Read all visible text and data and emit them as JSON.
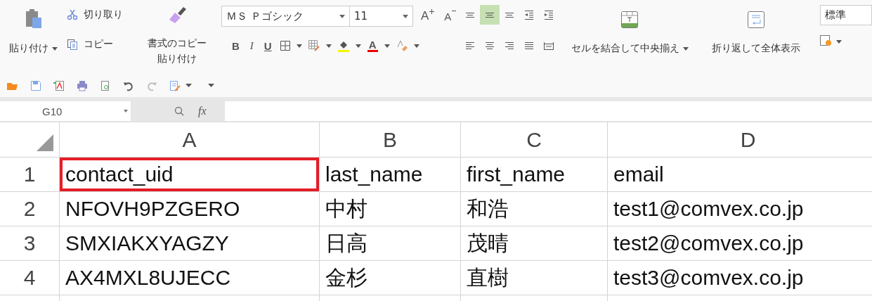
{
  "ribbon": {
    "clipboard": {
      "paste": "貼り付け",
      "cut": "切り取り",
      "copy": "コピー",
      "format_painter": "書式のコピー貼り付け"
    },
    "font": {
      "name": "ＭＳ Ｐゴシック",
      "size": "11",
      "grow": "A",
      "shrink": "A",
      "bold": "B",
      "italic": "I",
      "underline": "U",
      "font_color": "A"
    },
    "alignment": [
      {
        "kind": "top",
        "selected": false
      },
      {
        "kind": "middle",
        "selected": true
      },
      {
        "kind": "bottom",
        "selected": false
      },
      {
        "kind": "outdent",
        "selected": false
      },
      {
        "kind": "indent",
        "selected": false
      },
      {
        "kind": "left",
        "selected": false
      },
      {
        "kind": "center",
        "selected": false
      },
      {
        "kind": "right",
        "selected": false
      },
      {
        "kind": "justify",
        "selected": false
      },
      {
        "kind": "distributed",
        "selected": false
      }
    ],
    "merge": "セルを結合して中央揃え",
    "wrap": "折り返して全体表示",
    "number_format": "標準",
    "quick_access": [
      {
        "kind": "open",
        "disabled": false
      },
      {
        "kind": "save",
        "disabled": false
      },
      {
        "kind": "pdf",
        "disabled": false
      },
      {
        "kind": "print",
        "disabled": false
      },
      {
        "kind": "preview",
        "disabled": false
      },
      {
        "kind": "undo",
        "disabled": false
      },
      {
        "kind": "redo",
        "disabled": true
      },
      {
        "kind": "form",
        "disabled": false
      }
    ]
  },
  "formula_bar": {
    "name_box": "G10",
    "fx": "fx"
  },
  "sheet": {
    "columns": [
      "A",
      "B",
      "C",
      "D"
    ],
    "rows": [
      {
        "header": "1",
        "cells": [
          {
            "text": "contact_uid",
            "highlighted": true
          },
          {
            "text": "last_name",
            "highlighted": false
          },
          {
            "text": "first_name",
            "highlighted": false
          },
          {
            "text": "email",
            "highlighted": false
          }
        ]
      },
      {
        "header": "2",
        "cells": [
          {
            "text": "NFOVH9PZGERO",
            "highlighted": false
          },
          {
            "text": "中村",
            "highlighted": false
          },
          {
            "text": "和浩",
            "highlighted": false
          },
          {
            "text": "test1@comvex.co.jp",
            "highlighted": false
          }
        ]
      },
      {
        "header": "3",
        "cells": [
          {
            "text": "SMXIAKXYAGZY",
            "highlighted": false
          },
          {
            "text": "日高",
            "highlighted": false
          },
          {
            "text": "茂晴",
            "highlighted": false
          },
          {
            "text": "test2@comvex.co.jp",
            "highlighted": false
          }
        ]
      },
      {
        "header": "4",
        "cells": [
          {
            "text": "AX4MXL8UJECC",
            "highlighted": false
          },
          {
            "text": "金杉",
            "highlighted": false
          },
          {
            "text": "直樹",
            "highlighted": false
          },
          {
            "text": "test3@comvex.co.jp",
            "highlighted": false
          }
        ]
      }
    ]
  }
}
